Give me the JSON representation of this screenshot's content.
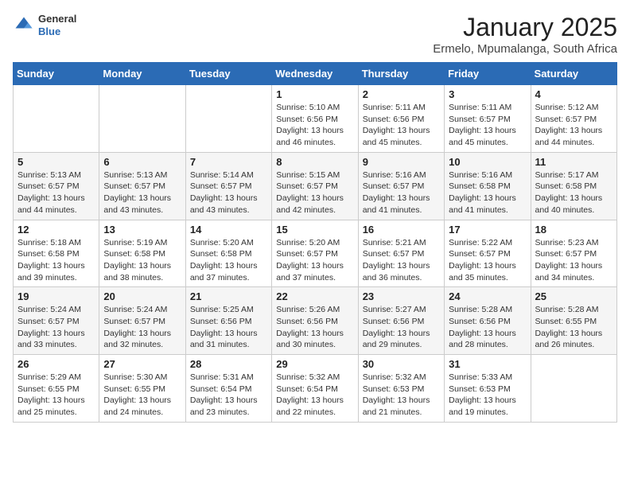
{
  "header": {
    "logo_line1": "General",
    "logo_line2": "Blue",
    "title": "January 2025",
    "subtitle": "Ermelo, Mpumalanga, South Africa"
  },
  "days_of_week": [
    "Sunday",
    "Monday",
    "Tuesday",
    "Wednesday",
    "Thursday",
    "Friday",
    "Saturday"
  ],
  "weeks": [
    [
      {
        "num": "",
        "info": ""
      },
      {
        "num": "",
        "info": ""
      },
      {
        "num": "",
        "info": ""
      },
      {
        "num": "1",
        "info": "Sunrise: 5:10 AM\nSunset: 6:56 PM\nDaylight: 13 hours and 46 minutes."
      },
      {
        "num": "2",
        "info": "Sunrise: 5:11 AM\nSunset: 6:56 PM\nDaylight: 13 hours and 45 minutes."
      },
      {
        "num": "3",
        "info": "Sunrise: 5:11 AM\nSunset: 6:57 PM\nDaylight: 13 hours and 45 minutes."
      },
      {
        "num": "4",
        "info": "Sunrise: 5:12 AM\nSunset: 6:57 PM\nDaylight: 13 hours and 44 minutes."
      }
    ],
    [
      {
        "num": "5",
        "info": "Sunrise: 5:13 AM\nSunset: 6:57 PM\nDaylight: 13 hours and 44 minutes."
      },
      {
        "num": "6",
        "info": "Sunrise: 5:13 AM\nSunset: 6:57 PM\nDaylight: 13 hours and 43 minutes."
      },
      {
        "num": "7",
        "info": "Sunrise: 5:14 AM\nSunset: 6:57 PM\nDaylight: 13 hours and 43 minutes."
      },
      {
        "num": "8",
        "info": "Sunrise: 5:15 AM\nSunset: 6:57 PM\nDaylight: 13 hours and 42 minutes."
      },
      {
        "num": "9",
        "info": "Sunrise: 5:16 AM\nSunset: 6:57 PM\nDaylight: 13 hours and 41 minutes."
      },
      {
        "num": "10",
        "info": "Sunrise: 5:16 AM\nSunset: 6:58 PM\nDaylight: 13 hours and 41 minutes."
      },
      {
        "num": "11",
        "info": "Sunrise: 5:17 AM\nSunset: 6:58 PM\nDaylight: 13 hours and 40 minutes."
      }
    ],
    [
      {
        "num": "12",
        "info": "Sunrise: 5:18 AM\nSunset: 6:58 PM\nDaylight: 13 hours and 39 minutes."
      },
      {
        "num": "13",
        "info": "Sunrise: 5:19 AM\nSunset: 6:58 PM\nDaylight: 13 hours and 38 minutes."
      },
      {
        "num": "14",
        "info": "Sunrise: 5:20 AM\nSunset: 6:58 PM\nDaylight: 13 hours and 37 minutes."
      },
      {
        "num": "15",
        "info": "Sunrise: 5:20 AM\nSunset: 6:57 PM\nDaylight: 13 hours and 37 minutes."
      },
      {
        "num": "16",
        "info": "Sunrise: 5:21 AM\nSunset: 6:57 PM\nDaylight: 13 hours and 36 minutes."
      },
      {
        "num": "17",
        "info": "Sunrise: 5:22 AM\nSunset: 6:57 PM\nDaylight: 13 hours and 35 minutes."
      },
      {
        "num": "18",
        "info": "Sunrise: 5:23 AM\nSunset: 6:57 PM\nDaylight: 13 hours and 34 minutes."
      }
    ],
    [
      {
        "num": "19",
        "info": "Sunrise: 5:24 AM\nSunset: 6:57 PM\nDaylight: 13 hours and 33 minutes."
      },
      {
        "num": "20",
        "info": "Sunrise: 5:24 AM\nSunset: 6:57 PM\nDaylight: 13 hours and 32 minutes."
      },
      {
        "num": "21",
        "info": "Sunrise: 5:25 AM\nSunset: 6:56 PM\nDaylight: 13 hours and 31 minutes."
      },
      {
        "num": "22",
        "info": "Sunrise: 5:26 AM\nSunset: 6:56 PM\nDaylight: 13 hours and 30 minutes."
      },
      {
        "num": "23",
        "info": "Sunrise: 5:27 AM\nSunset: 6:56 PM\nDaylight: 13 hours and 29 minutes."
      },
      {
        "num": "24",
        "info": "Sunrise: 5:28 AM\nSunset: 6:56 PM\nDaylight: 13 hours and 28 minutes."
      },
      {
        "num": "25",
        "info": "Sunrise: 5:28 AM\nSunset: 6:55 PM\nDaylight: 13 hours and 26 minutes."
      }
    ],
    [
      {
        "num": "26",
        "info": "Sunrise: 5:29 AM\nSunset: 6:55 PM\nDaylight: 13 hours and 25 minutes."
      },
      {
        "num": "27",
        "info": "Sunrise: 5:30 AM\nSunset: 6:55 PM\nDaylight: 13 hours and 24 minutes."
      },
      {
        "num": "28",
        "info": "Sunrise: 5:31 AM\nSunset: 6:54 PM\nDaylight: 13 hours and 23 minutes."
      },
      {
        "num": "29",
        "info": "Sunrise: 5:32 AM\nSunset: 6:54 PM\nDaylight: 13 hours and 22 minutes."
      },
      {
        "num": "30",
        "info": "Sunrise: 5:32 AM\nSunset: 6:53 PM\nDaylight: 13 hours and 21 minutes."
      },
      {
        "num": "31",
        "info": "Sunrise: 5:33 AM\nSunset: 6:53 PM\nDaylight: 13 hours and 19 minutes."
      },
      {
        "num": "",
        "info": ""
      }
    ]
  ]
}
